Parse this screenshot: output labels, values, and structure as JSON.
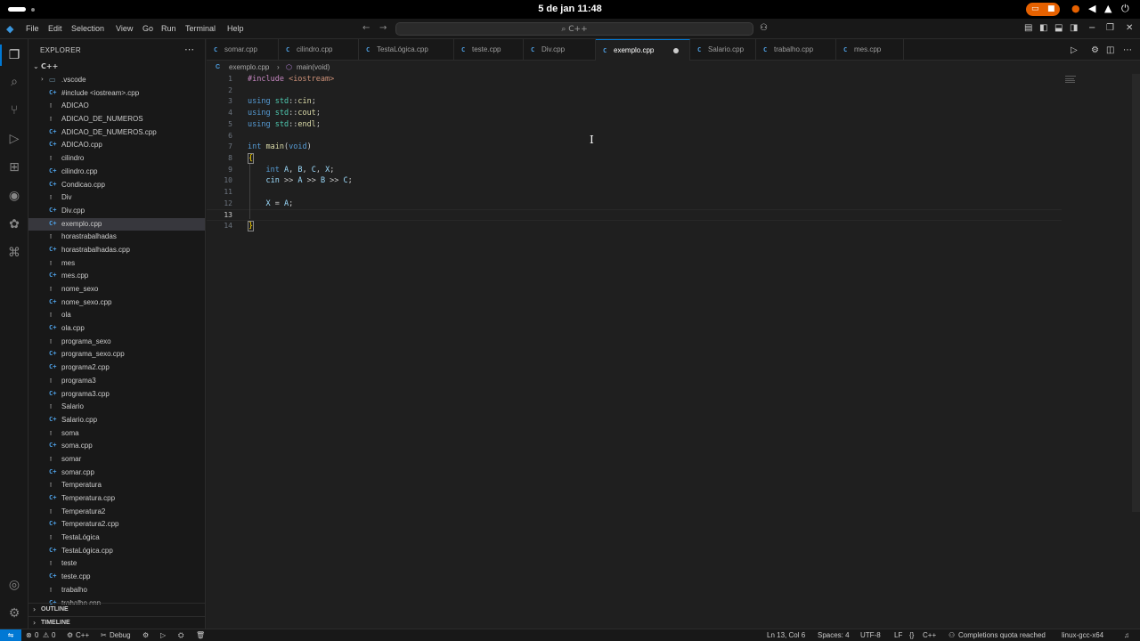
{
  "system_bar": {
    "clock": "5 de jan  11:48",
    "tray_icons": [
      "cast-icon",
      "microphone-icon",
      "volume-icon",
      "network-icon",
      "power-icon"
    ]
  },
  "titlebar": {
    "menu": [
      "File",
      "Edit",
      "Selection",
      "View",
      "Go",
      "Run",
      "Terminal",
      "Help"
    ],
    "search_label": "C++"
  },
  "sidebar": {
    "title": "EXPLORER",
    "folder": "C++",
    "items": [
      {
        "name": ".vscode",
        "type": "dir"
      },
      {
        "name": "#include <iostream>.cpp",
        "type": "cpp"
      },
      {
        "name": "ADICAO",
        "type": "plain"
      },
      {
        "name": "ADICAO_DE_NUMEROS",
        "type": "plain"
      },
      {
        "name": "ADICAO_DE_NUMEROS.cpp",
        "type": "cpp"
      },
      {
        "name": "ADICAO.cpp",
        "type": "cpp"
      },
      {
        "name": "cilindro",
        "type": "plain"
      },
      {
        "name": "cilindro.cpp",
        "type": "cpp"
      },
      {
        "name": "Condicao.cpp",
        "type": "cpp"
      },
      {
        "name": "Div",
        "type": "plain"
      },
      {
        "name": "Div.cpp",
        "type": "cpp"
      },
      {
        "name": "exemplo.cpp",
        "type": "cpp",
        "selected": true
      },
      {
        "name": "horastrabalhadas",
        "type": "plain"
      },
      {
        "name": "horastrabalhadas.cpp",
        "type": "cpp"
      },
      {
        "name": "mes",
        "type": "plain"
      },
      {
        "name": "mes.cpp",
        "type": "cpp"
      },
      {
        "name": "nome_sexo",
        "type": "plain"
      },
      {
        "name": "nome_sexo.cpp",
        "type": "cpp"
      },
      {
        "name": "ola",
        "type": "plain"
      },
      {
        "name": "ola.cpp",
        "type": "cpp"
      },
      {
        "name": "programa_sexo",
        "type": "plain"
      },
      {
        "name": "programa_sexo.cpp",
        "type": "cpp"
      },
      {
        "name": "programa2.cpp",
        "type": "cpp"
      },
      {
        "name": "programa3",
        "type": "plain"
      },
      {
        "name": "programa3.cpp",
        "type": "cpp"
      },
      {
        "name": "Salario",
        "type": "plain"
      },
      {
        "name": "Salario.cpp",
        "type": "cpp"
      },
      {
        "name": "soma",
        "type": "plain"
      },
      {
        "name": "soma.cpp",
        "type": "cpp"
      },
      {
        "name": "somar",
        "type": "plain"
      },
      {
        "name": "somar.cpp",
        "type": "cpp"
      },
      {
        "name": "Temperatura",
        "type": "plain"
      },
      {
        "name": "Temperatura.cpp",
        "type": "cpp"
      },
      {
        "name": "Temperatura2",
        "type": "plain"
      },
      {
        "name": "Temperatura2.cpp",
        "type": "cpp"
      },
      {
        "name": "TestaLógica",
        "type": "plain"
      },
      {
        "name": "TestaLógica.cpp",
        "type": "cpp"
      },
      {
        "name": "teste",
        "type": "plain"
      },
      {
        "name": "teste.cpp",
        "type": "cpp"
      },
      {
        "name": "trabalho",
        "type": "plain"
      },
      {
        "name": "trabalho.cpp",
        "type": "cpp"
      }
    ],
    "outline_label": "OUTLINE",
    "timeline_label": "TIMELINE"
  },
  "tabs": [
    {
      "label": "somar.cpp"
    },
    {
      "label": "cilindro.cpp"
    },
    {
      "label": "TestaLógica.cpp"
    },
    {
      "label": "teste.cpp"
    },
    {
      "label": "Div.cpp"
    },
    {
      "label": "exemplo.cpp",
      "active": true,
      "dirty": true
    },
    {
      "label": "Salario.cpp"
    },
    {
      "label": "trabalho.cpp"
    },
    {
      "label": "mes.cpp"
    }
  ],
  "breadcrumb": {
    "file": "exemplo.cpp",
    "symbol": "main(void)"
  },
  "editor": {
    "current_line": 13,
    "lines": [
      "#include <iostream>",
      "",
      "using std::cin;",
      "using std::cout;",
      "using std::endl;",
      "",
      "int main(void)",
      "{",
      "    int A, B, C, X;",
      "    cin >> A >> B >> C;",
      "",
      "    X = A;",
      "",
      "}"
    ]
  },
  "statusbar": {
    "problems": "0",
    "warnings": "0",
    "language_left": "C++",
    "debug": "Debug",
    "cursor_pos": "Ln 13, Col 6",
    "spaces": "Spaces: 4",
    "encoding": "UTF-8",
    "eol": "LF",
    "language": "C++",
    "copilot": "Completions quota reached",
    "config": "linux-gcc-x64"
  },
  "colors": {
    "accent": "#0078d4",
    "editor_bg": "#1f1f1f",
    "sidebar_bg": "#181818",
    "keyword": "#569cd6",
    "preprocessor": "#c586c0",
    "string": "#ce9178",
    "function": "#dcdcaa",
    "variable": "#9cdcfe",
    "namespace": "#4ec9b0"
  }
}
